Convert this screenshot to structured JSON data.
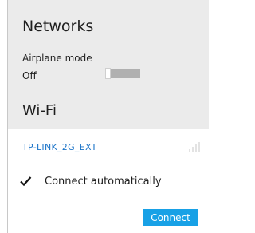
{
  "panel": {
    "title": "Networks",
    "airplane_mode": {
      "label": "Airplane mode",
      "state": "Off",
      "enabled": false
    },
    "wifi_header": "Wi-Fi"
  },
  "network": {
    "name": "TP-LINK_2G_EXT",
    "signal_icon": "wifi-signal-icon",
    "connect_auto": {
      "label": "Connect automatically",
      "checked": true,
      "icon": "checkmark-icon"
    },
    "connect_button": "Connect"
  },
  "colors": {
    "panel_bg": "#ebebeb",
    "accent": "#18a1e6",
    "network_name": "#1a73c8",
    "toggle_track": "#b0b0b0"
  }
}
